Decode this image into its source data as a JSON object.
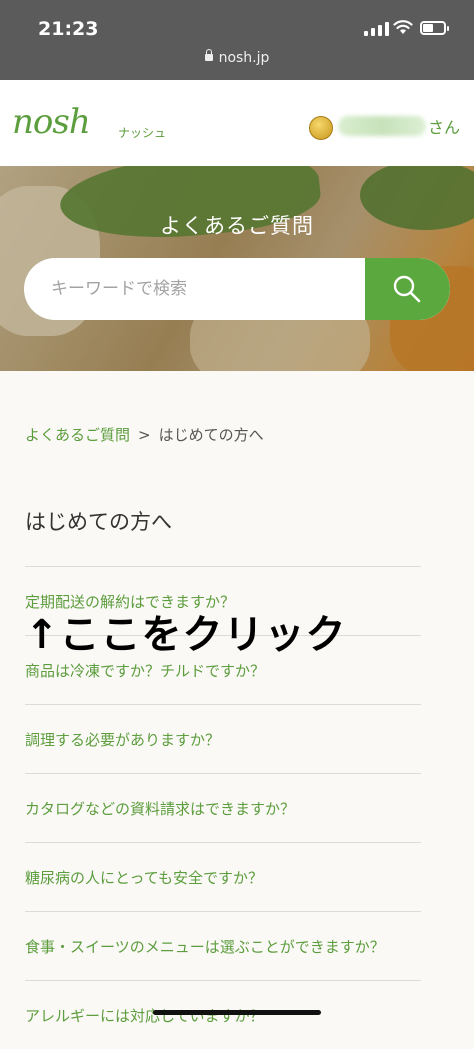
{
  "status_bar": {
    "time": "21:23",
    "url": "nosh.jp"
  },
  "header": {
    "logo": "nosh",
    "logo_sub": "ナッシュ",
    "user_suffix": "さん"
  },
  "hero": {
    "title": "よくあるご質問",
    "search_placeholder": "キーワードで検索"
  },
  "breadcrumb": {
    "link": "よくあるご質問",
    "separator": ">",
    "current": "はじめての方へ"
  },
  "page_title": "はじめての方へ",
  "faq": [
    "定期配送の解約はできますか？",
    "商品は冷凍ですか？チルドですか？",
    "調理する必要がありますか？",
    "カタログなどの資料請求はできますか？",
    "糖尿病の人にとっても安全ですか？",
    "食事・スイーツのメニューは選ぶことができますか？",
    "アレルギーには対応していますか？"
  ],
  "annotation": "↑ここをクリック",
  "colors": {
    "accent": "#5aa83e",
    "link": "#5c9d3d",
    "status_bar": "#5b5b5b"
  }
}
